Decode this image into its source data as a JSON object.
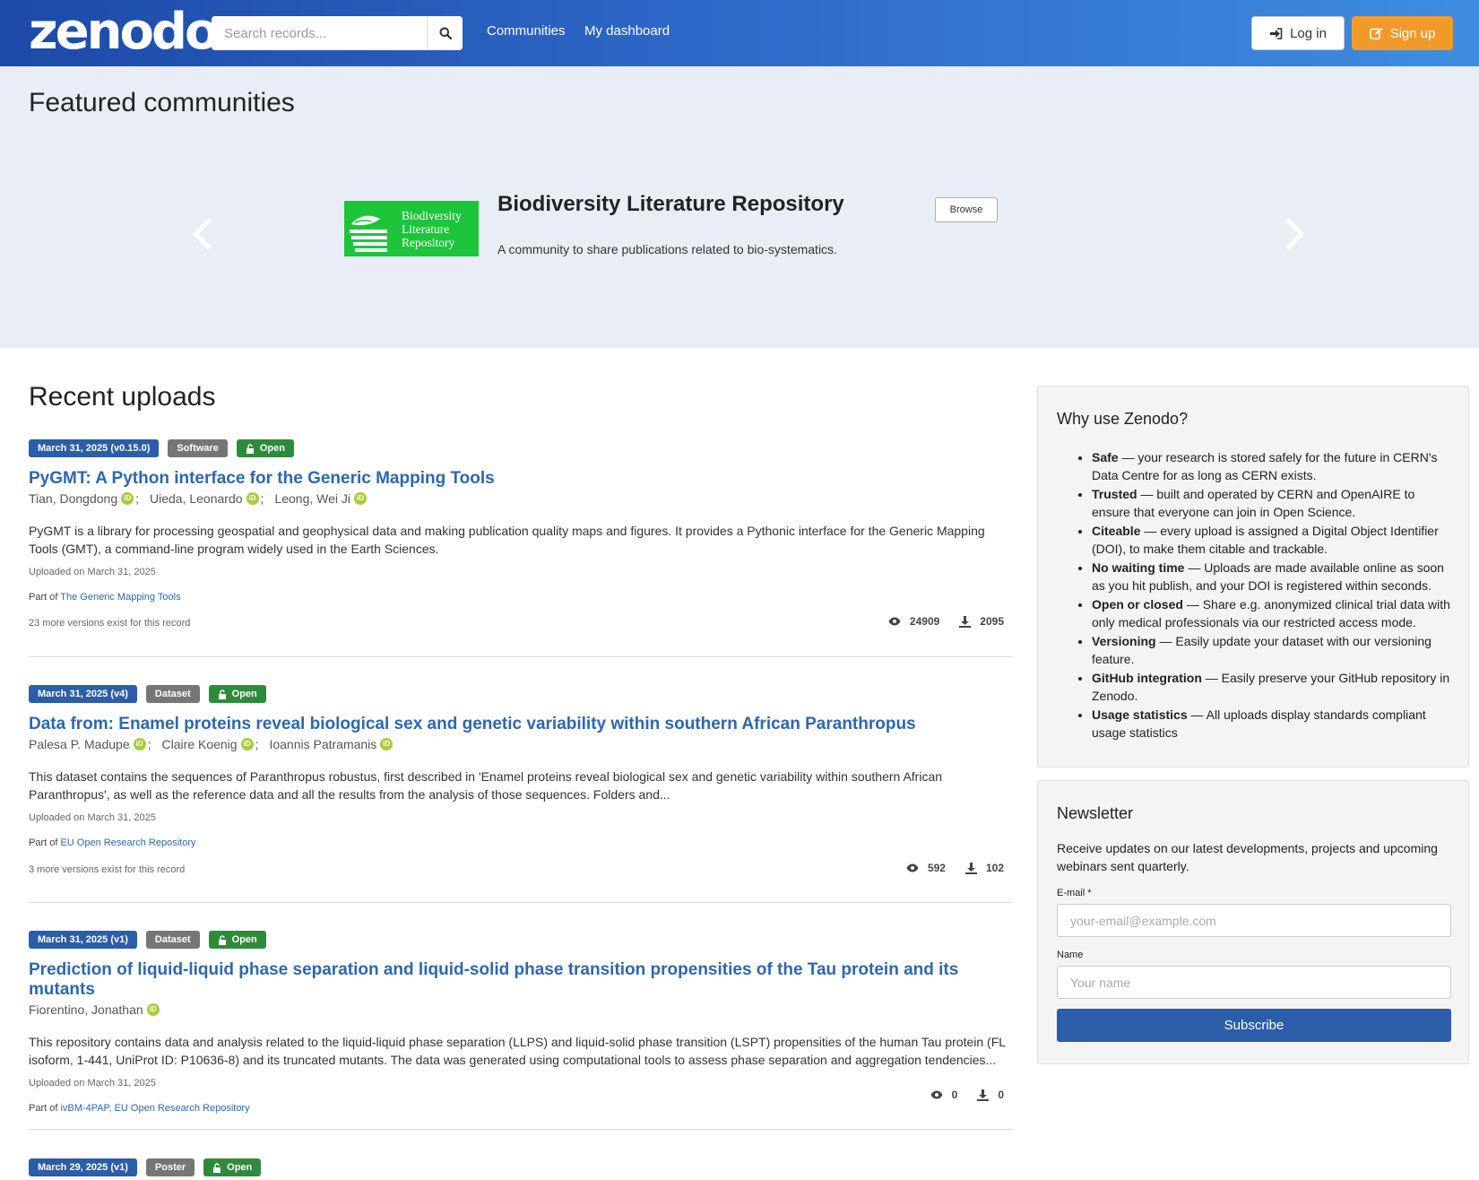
{
  "header": {
    "logo": "zenodo",
    "search_placeholder": "Search records...",
    "nav": [
      "Communities",
      "My dashboard"
    ],
    "login_label": "Log in",
    "signup_label": "Sign up"
  },
  "featured": {
    "heading": "Featured communities",
    "logo_text": [
      "Biodiversity",
      "Literature",
      "Repository"
    ],
    "title": "Biodiversity Literature Repository",
    "description": "A community to share publications related to bio-systematics.",
    "browse_label": "Browse"
  },
  "recent": {
    "heading": "Recent uploads",
    "records": [
      {
        "date_label": "March 31, 2025 (v0.15.0)",
        "type_label": "Software",
        "access_label": "Open",
        "title": "PyGMT: A Python interface for the Generic Mapping Tools",
        "authors": [
          "Tian, Dongdong",
          "Uieda, Leonardo",
          "Leong, Wei Ji"
        ],
        "description": "PyGMT is a library for processing geospatial and geophysical data and making publication quality maps and figures. It provides a Pythonic interface for the Generic Mapping Tools (GMT), a command-line program widely used in the Earth Sciences.",
        "uploaded": "Uploaded on March 31, 2025",
        "part_of_prefix": "Part of",
        "part_of": "The Generic Mapping Tools",
        "versions": "23 more versions exist for this record",
        "views": "24909",
        "downloads": "2095"
      },
      {
        "date_label": "March 31, 2025 (v4)",
        "type_label": "Dataset",
        "access_label": "Open",
        "title": "Data from: Enamel proteins reveal biological sex and genetic variability within southern African Paranthropus",
        "authors": [
          "Palesa P. Madupe",
          "Claire Koenig",
          "Ioannis Patramanis"
        ],
        "description": "This dataset contains the sequences of Paranthropus robustus, first described in 'Enamel proteins reveal biological sex and genetic variability within southern African Paranthropus', as well as the reference data and all the results from the analysis of those sequences. Folders and...",
        "uploaded": "Uploaded on March 31, 2025",
        "part_of_prefix": "Part of",
        "part_of": "EU Open Research Repository",
        "versions": "3 more versions exist for this record",
        "views": "592",
        "downloads": "102"
      },
      {
        "date_label": "March 31, 2025 (v1)",
        "type_label": "Dataset",
        "access_label": "Open",
        "title": "Prediction of liquid-liquid phase separation and liquid-solid phase transition propensities of the Tau protein and its mutants",
        "authors": [
          "Fiorentino, Jonathan"
        ],
        "description": "This repository contains data and analysis related to the liquid-liquid phase separation (LLPS) and liquid-solid phase transition (LSPT) propensities of the human Tau protein (FL isoform, 1-441, UniProt ID: P10636-8) and its truncated mutants. The data was generated using computational tools to assess phase separation and aggregation tendencies...",
        "uploaded": "Uploaded on March 31, 2025",
        "part_of_prefix": "Part of",
        "part_of": "ivBM-4PAP, EU Open Research Repository",
        "views": "0",
        "downloads": "0"
      },
      {
        "date_label": "March 29, 2025 (v1)",
        "type_label": "Poster",
        "access_label": "Open"
      }
    ]
  },
  "why": {
    "heading": "Why use Zenodo?",
    "items": [
      {
        "bold": "Safe",
        "text": " — your research is stored safely for the future in CERN's Data Centre for as long as CERN exists."
      },
      {
        "bold": "Trusted",
        "text": " — built and operated by CERN and OpenAIRE to ensure that everyone can join in Open Science."
      },
      {
        "bold": "Citeable",
        "text": " — every upload is assigned a Digital Object Identifier (DOI), to make them citable and trackable."
      },
      {
        "bold": "No waiting time",
        "text": " — Uploads are made available online as soon as you hit publish, and your DOI is registered within seconds."
      },
      {
        "bold": "Open or closed",
        "text": " — Share e.g. anonymized clinical trial data with only medical professionals via our restricted access mode."
      },
      {
        "bold": "Versioning",
        "text": " — Easily update your dataset with our versioning feature."
      },
      {
        "bold": "GitHub integration",
        "text": " — Easily preserve your GitHub repository in Zenodo."
      },
      {
        "bold": "Usage statistics",
        "text": " — All uploads display standards compliant usage statistics"
      }
    ]
  },
  "newsletter": {
    "heading": "Newsletter",
    "description": "Receive updates on our latest developments, projects and upcoming webinars sent quarterly.",
    "email_label": "E-mail *",
    "email_placeholder": "your-email@example.com",
    "name_label": "Name",
    "name_placeholder": "Your name",
    "subscribe_label": "Subscribe"
  }
}
